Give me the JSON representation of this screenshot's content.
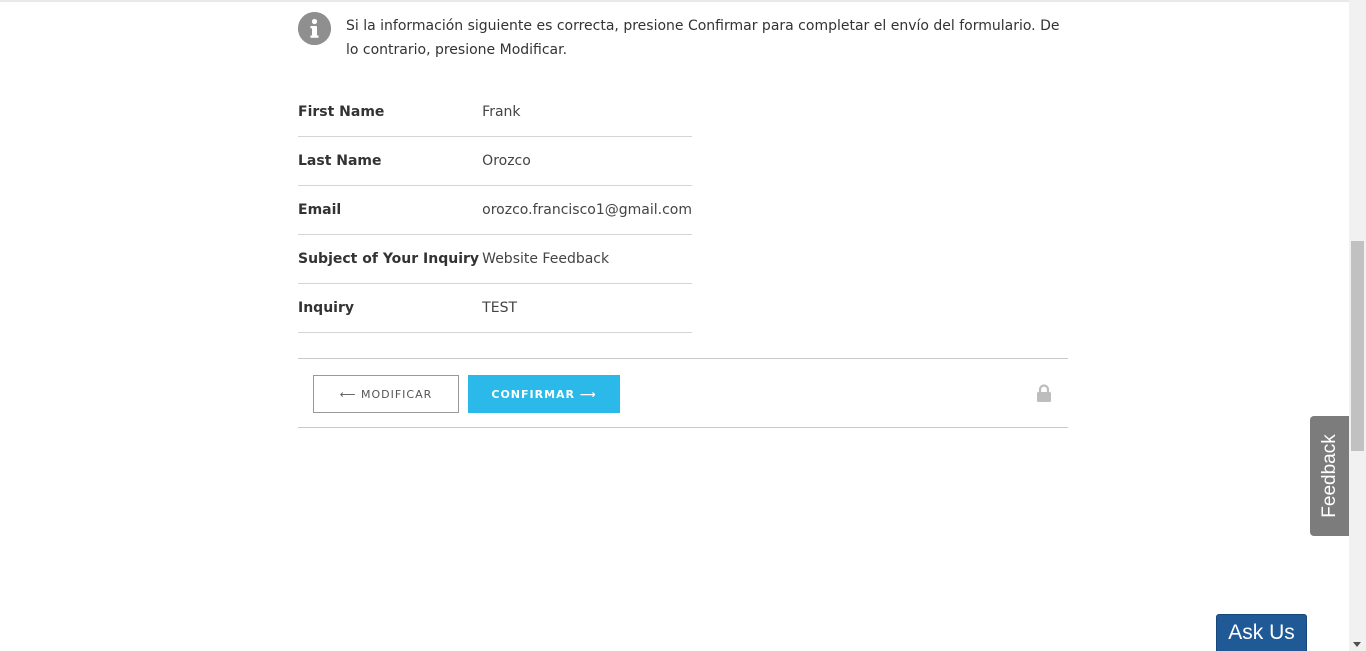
{
  "notice": {
    "icon": "info-icon",
    "text": "Si la información siguiente es correcta, presione Confirmar para completar el envío del formulario. De lo contrario, presione Modificar."
  },
  "fields": [
    {
      "label": "First Name",
      "value": "Frank"
    },
    {
      "label": "Last Name",
      "value": "Orozco"
    },
    {
      "label": "Email",
      "value": "orozco.francisco1@gmail.com"
    },
    {
      "label": "Subject of Your Inquiry",
      "value": "Website Feedback"
    },
    {
      "label": "Inquiry",
      "value": "TEST"
    }
  ],
  "actions": {
    "modify_label": "⟵ MODIFICAR",
    "confirm_label": "CONFIRMAR ⟶",
    "lock_icon": "lock-icon",
    "confirm_color": "#2ab9e8"
  },
  "widgets": {
    "feedback_label": "Feedback",
    "ask_us_label": "Ask Us",
    "ask_us_color": "#1f5a96"
  }
}
